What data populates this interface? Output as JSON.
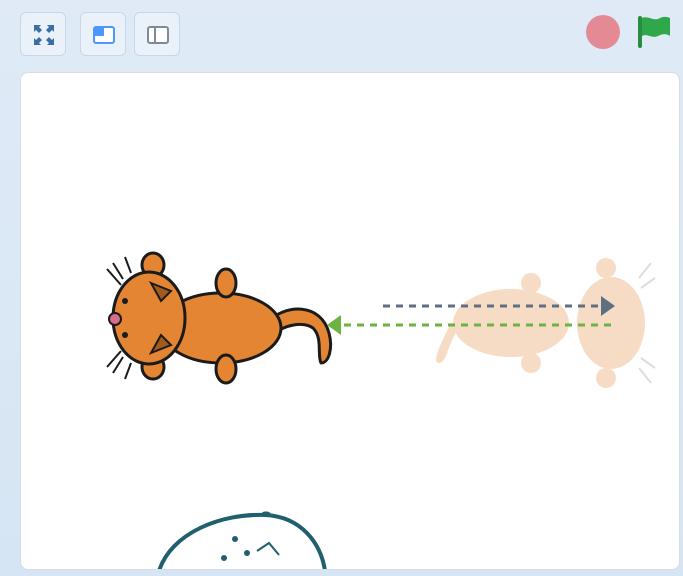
{
  "toolbar": {
    "buttons": [
      {
        "name": "fullscreen",
        "icon": "expand-arrows-icon"
      },
      {
        "name": "small-stage",
        "icon": "small-stage-layout-icon"
      },
      {
        "name": "large-stage",
        "icon": "large-stage-layout-icon"
      }
    ],
    "stop_icon": "stop-icon",
    "flag_icon": "green-flag-icon"
  },
  "colors": {
    "accent": "#4c97ff",
    "flag_green": "#2ea84a",
    "stop_red": "#e46a73",
    "cat_orange": "#e38533",
    "arrow_gray": "#5d6f80",
    "arrow_green": "#6cb33f"
  },
  "stage": {
    "sprites": [
      {
        "name": "cat-sprite",
        "facing": "left",
        "visible": true
      },
      {
        "name": "cat-sprite-ghost",
        "facing": "right",
        "visible": "faded"
      }
    ],
    "arrows": [
      {
        "name": "arrow-right",
        "direction": "right",
        "style": "dashed"
      },
      {
        "name": "arrow-left",
        "direction": "left",
        "style": "dashed"
      }
    ]
  }
}
